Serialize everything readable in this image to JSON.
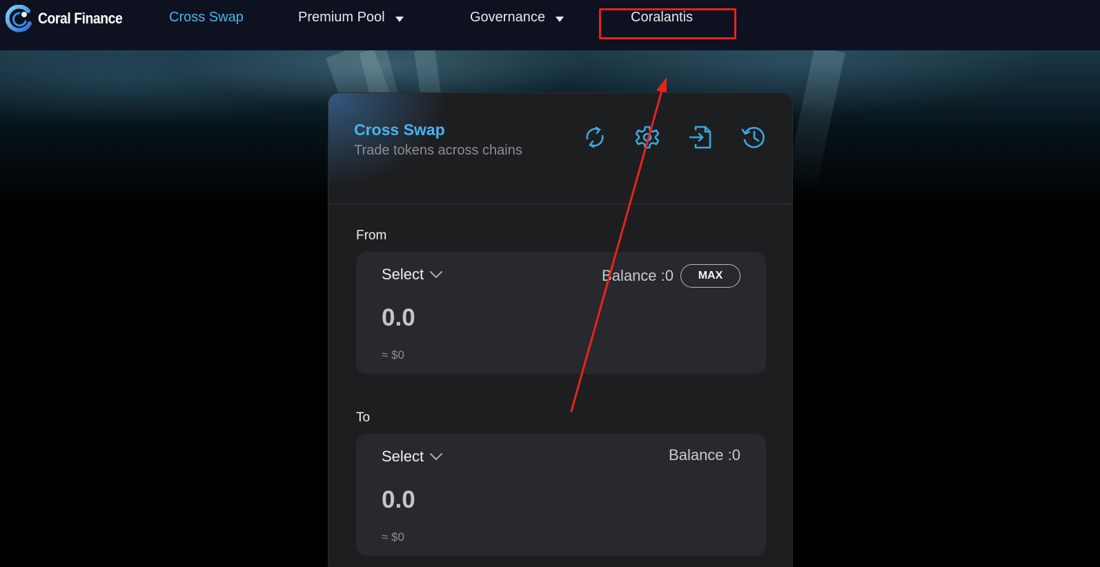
{
  "brand": {
    "name": "Coral Finance",
    "logo_icon": "coral-logo-icon"
  },
  "nav": {
    "items": [
      {
        "label": "Cross Swap",
        "active": true
      },
      {
        "label": "Premium Pool",
        "has_dropdown": true
      },
      {
        "label": "Governance",
        "has_dropdown": true
      },
      {
        "label": "Coralantis"
      }
    ]
  },
  "swap_card": {
    "title": "Cross Swap",
    "subtitle": "Trade tokens across chains",
    "tools": [
      "refresh-icon",
      "settings-gear-icon",
      "import-icon",
      "history-icon"
    ],
    "from": {
      "label": "From",
      "select_label": "Select",
      "balance": "Balance :0",
      "max_label": "MAX",
      "amount": "0.0",
      "usd": "≈ $0"
    },
    "to": {
      "label": "To",
      "select_label": "Select",
      "balance": "Balance :0",
      "amount": "0.0",
      "usd": "≈ $0"
    }
  },
  "colors": {
    "accent": "#49b4ec",
    "nav_bg": "#0e1220",
    "card_bg": "#1d1e20",
    "panel_bg": "#28292c",
    "annotation_red": "#e8231c"
  }
}
